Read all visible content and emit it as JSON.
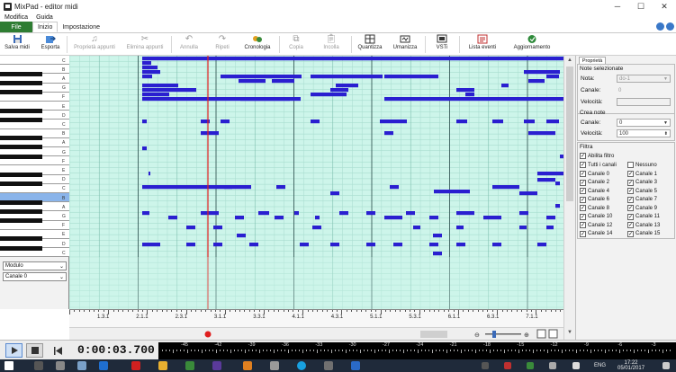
{
  "window": {
    "title": "MixPad - editor midi"
  },
  "menu": [
    "Modifica",
    "Guida"
  ],
  "tabs": {
    "file": "File",
    "home": "Inizio",
    "settings": "Impostazione"
  },
  "ribbon": {
    "save": "Salva midi",
    "export": "Esporta",
    "note_props": "Proprietà appunti",
    "delete_notes": "Elimina appunti",
    "undo": "Annulla",
    "redo": "Ripeti",
    "history": "Cronologia",
    "copy": "Copia",
    "paste": "Incolla",
    "quantize": "Quantizza",
    "humanize": "Umanizza",
    "vsti": "VSTi",
    "event_list": "Lista eventi",
    "update": "Aggiornamento"
  },
  "piano": {
    "labels": [
      "C",
      "B",
      "A",
      "G",
      "F",
      "E",
      "D",
      "C",
      "B",
      "A",
      "G",
      "F",
      "E",
      "D",
      "C",
      "B",
      "A",
      "G",
      "F",
      "E",
      "D",
      "C"
    ],
    "selected_index": 15
  },
  "module": {
    "mode": "Modulo",
    "channel": "Canale 0"
  },
  "ruler": {
    "bars": [
      "1.3.1",
      "2.1.1",
      "2.3.1",
      "3.1.1",
      "3.3.1",
      "4.1.1",
      "4.3.1",
      "5.1.1",
      "5.3.1",
      "6.1.1",
      "6.3.1",
      "7.1.1"
    ]
  },
  "properties": {
    "tab": "Proprietà",
    "selected_notes": {
      "title": "Note selezionate",
      "note_label": "Nota:",
      "note_value": "do-1",
      "channel_label": "Canale:",
      "channel_value": "0",
      "velocity_label": "Velocità:",
      "velocity_value": ""
    },
    "create_notes": {
      "title": "Crea note",
      "channel_label": "Canale:",
      "channel_value": "0",
      "velocity_label": "Velocità:",
      "velocity_value": "100"
    },
    "filter": {
      "title": "Filtra",
      "enable": "Abilita filtro",
      "all": "Tutti i canali",
      "none": "Nessuno",
      "channels": [
        "Canale 0",
        "Canale 1",
        "Canale 2",
        "Canale 3",
        "Canale 4",
        "Canale 5",
        "Canale 6",
        "Canale 7",
        "Canale 8",
        "Canale 9",
        "Canale 10",
        "Canale 11",
        "Canale 12",
        "Canale 13",
        "Canale 14",
        "Canale 15"
      ]
    }
  },
  "transport": {
    "time": "0:00:03.700",
    "meter_labels": [
      "-45",
      "-42",
      "-39",
      "-36",
      "-33",
      "-30",
      "-27",
      "-24",
      "-21",
      "-18",
      "-15",
      "-12",
      "-9",
      "-6",
      "-3",
      "0"
    ]
  },
  "taskbar": {
    "lang": "ENG",
    "time": "17:22",
    "date": "05/01/2017"
  },
  "colors": {
    "grid_bg": "#cdf5ea",
    "note": "#2a1fd0",
    "playhead": "#e02020",
    "file_tab": "#2e7d32"
  }
}
